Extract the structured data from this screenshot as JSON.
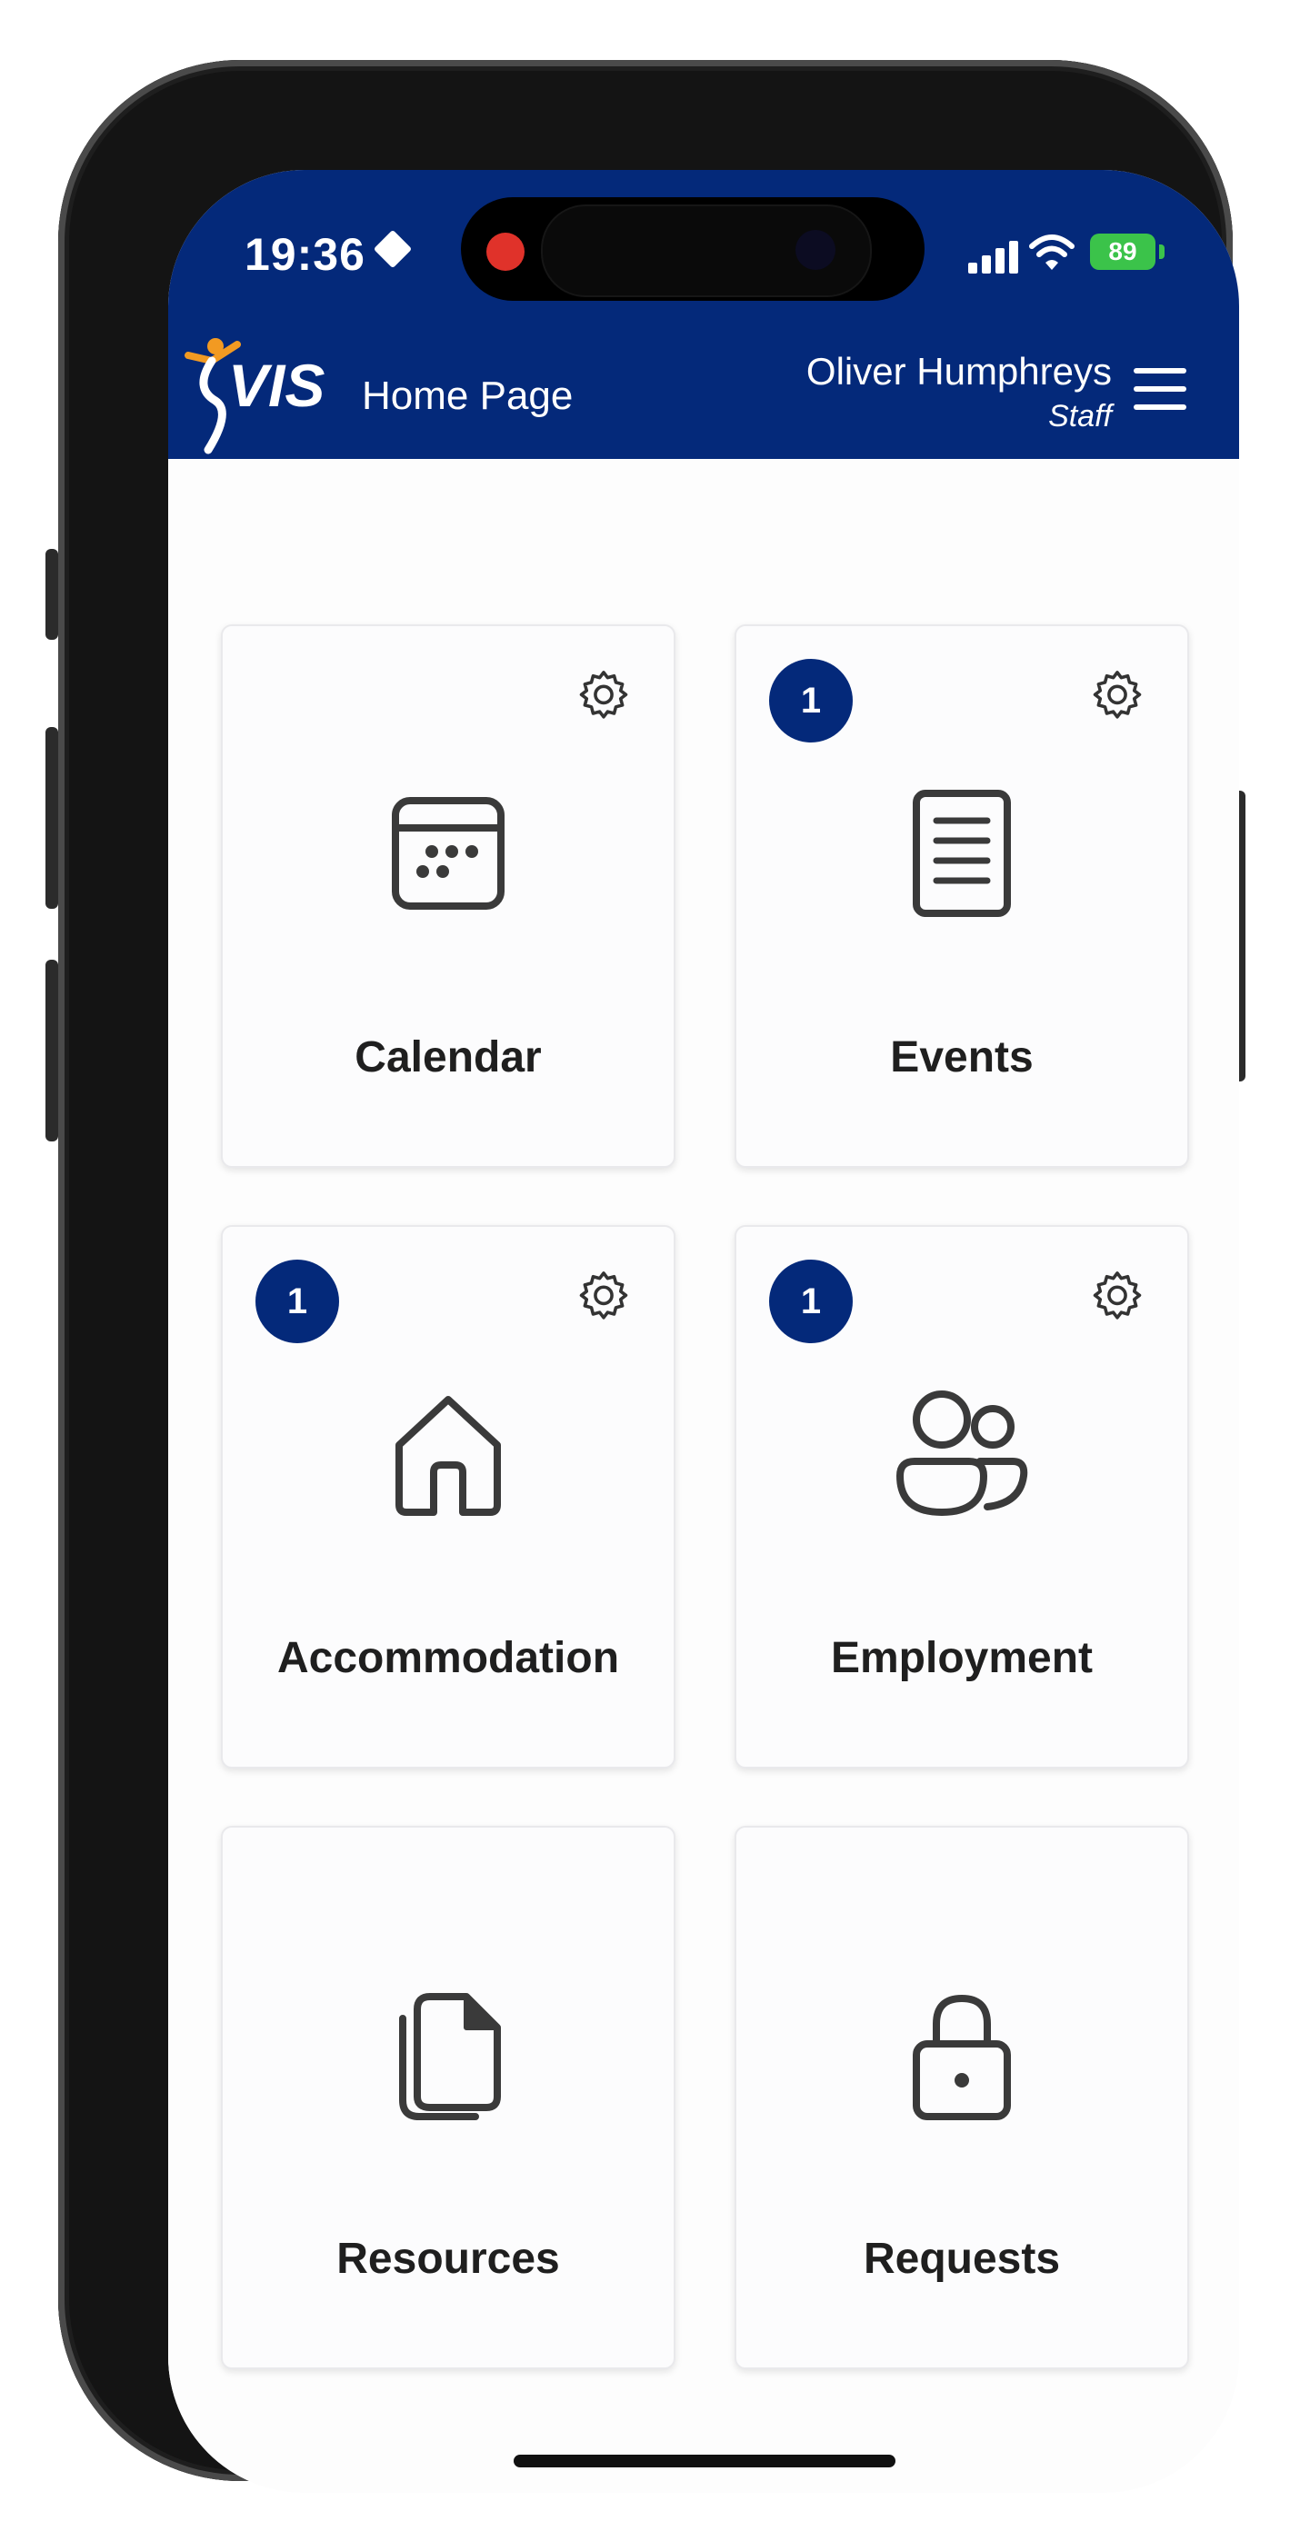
{
  "status_bar": {
    "time": "19:36",
    "battery": "89"
  },
  "header": {
    "app_logo_text": "VIS",
    "page_title": "Home Page",
    "user_name": "Oliver Humphreys",
    "user_role": "Staff"
  },
  "tiles": [
    {
      "label": "Calendar",
      "icon": "calendar-icon",
      "badge": "",
      "has_settings": true
    },
    {
      "label": "Events",
      "icon": "document-icon",
      "badge": "1",
      "has_settings": true
    },
    {
      "label": "Accommodation",
      "icon": "house-icon",
      "badge": "1",
      "has_settings": true
    },
    {
      "label": "Employment",
      "icon": "people-icon",
      "badge": "1",
      "has_settings": true
    },
    {
      "label": "Resources",
      "icon": "files-icon",
      "badge": "",
      "has_settings": false
    },
    {
      "label": "Requests",
      "icon": "lock-icon",
      "badge": "",
      "has_settings": false
    }
  ],
  "colors": {
    "brand_navy": "#04297a",
    "logo_orange": "#f29a22",
    "battery_green": "#3bc34a"
  }
}
